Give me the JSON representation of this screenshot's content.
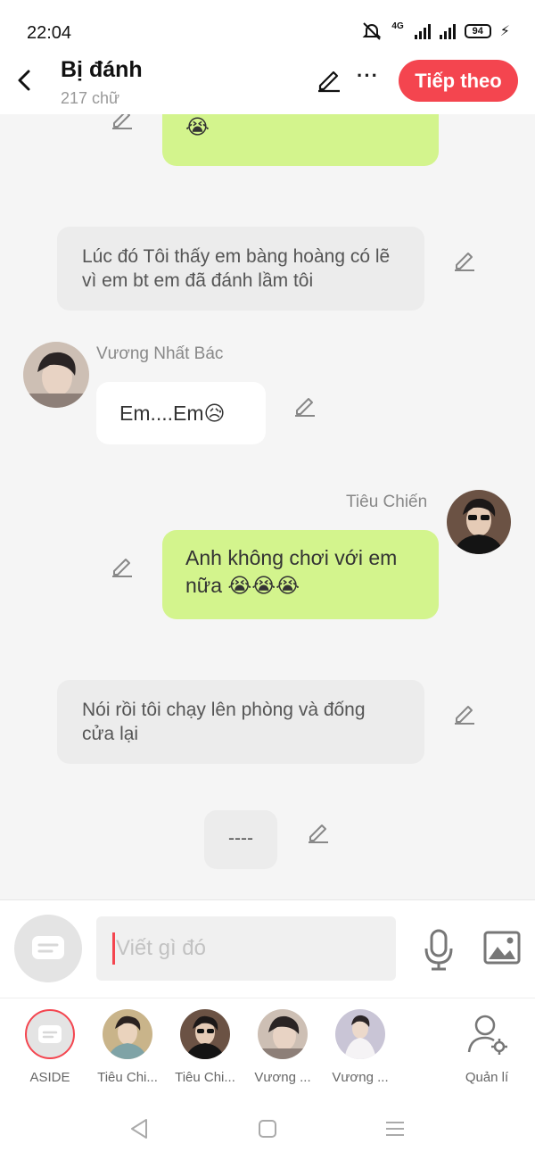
{
  "status": {
    "time": "22:04",
    "network": "4G",
    "battery": "94"
  },
  "header": {
    "title": "Bị đánh",
    "subtitle": "217 chữ",
    "next_label": "Tiếp theo"
  },
  "messages": {
    "m0": {
      "text": "Mà Em Đánh Anh 😭😭😭"
    },
    "m1": {
      "text": "Lúc đó Tôi thấy em bàng hoàng có lẽ vì em bt em đã đánh lầm tôi"
    },
    "m2": {
      "speaker": "Vương Nhất Bác",
      "text": "Em....Em😥"
    },
    "m3": {
      "speaker": "Tiêu Chiến",
      "text": "Anh không chơi với em nữa 😭😭😭"
    },
    "m4": {
      "text": "Nói rồi tôi chạy lên phòng và đống cửa lại"
    },
    "m5": {
      "text": "----"
    }
  },
  "input": {
    "placeholder": "Viết gì đó"
  },
  "characters": [
    {
      "label": "ASIDE"
    },
    {
      "label": "Tiêu Chi..."
    },
    {
      "label": "Tiêu Chi..."
    },
    {
      "label": "Vương ..."
    },
    {
      "label": "Vương ..."
    },
    {
      "label": "Quản lí"
    }
  ],
  "colors": {
    "accent": "#f4454f",
    "green_bubble": "#d3f48d",
    "gray_bubble": "#ececec"
  }
}
